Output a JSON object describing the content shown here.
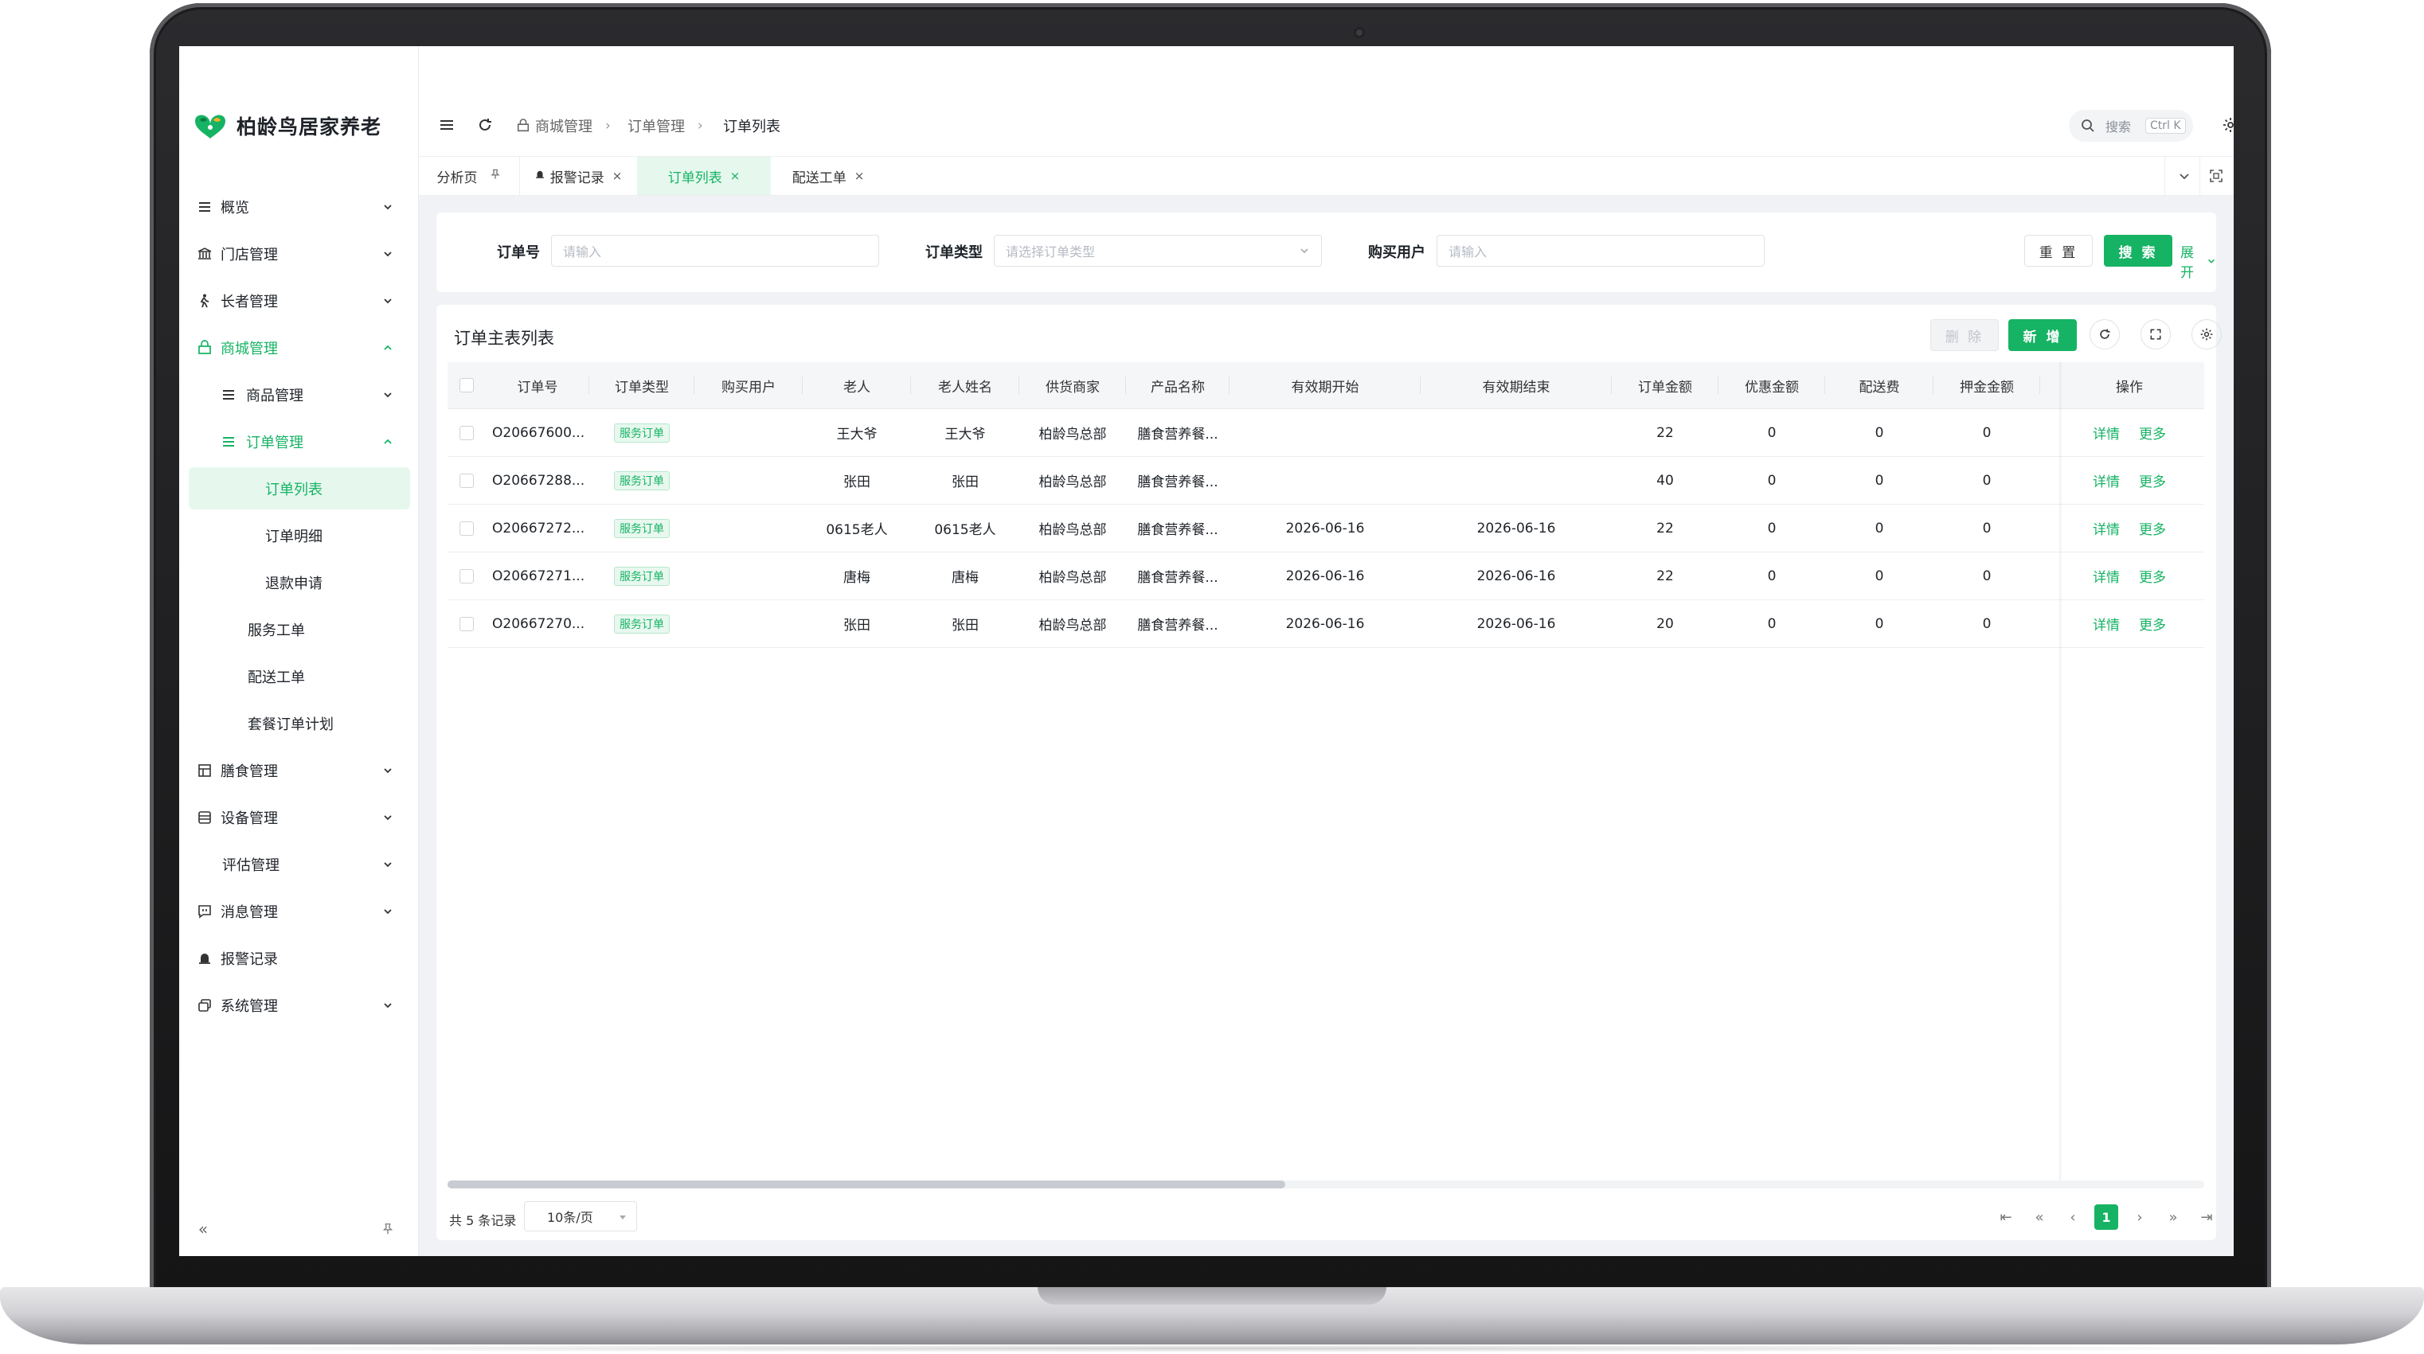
{
  "brand": {
    "name": "柏龄鸟居家养老",
    "accent": "#16b364"
  },
  "sidebar": {
    "items": [
      {
        "label": "概览",
        "icon": "list-icon",
        "chevron": "down"
      },
      {
        "label": "门店管理",
        "icon": "bank-icon",
        "chevron": "down"
      },
      {
        "label": "长者管理",
        "icon": "walking-person-icon",
        "chevron": "down"
      },
      {
        "label": "商城管理",
        "icon": "shop-icon",
        "chevron": "up",
        "expanded": true
      },
      {
        "label": "商品管理",
        "icon": "list-icon",
        "chevron": "down",
        "level": 2
      },
      {
        "label": "订单管理",
        "icon": "list-icon",
        "chevron": "up",
        "level": 2,
        "expanded": true
      },
      {
        "label": "订单列表",
        "level": 3,
        "active": true
      },
      {
        "label": "订单明细",
        "level": 3
      },
      {
        "label": "退款申请",
        "level": 3
      },
      {
        "label": "服务工单",
        "level": 2
      },
      {
        "label": "配送工单",
        "level": 2
      },
      {
        "label": "套餐订单计划",
        "level": 2
      },
      {
        "label": "膳食管理",
        "icon": "grid-icon",
        "chevron": "down"
      },
      {
        "label": "设备管理",
        "icon": "database-icon",
        "chevron": "down"
      },
      {
        "label": "评估管理",
        "chevron": "down"
      },
      {
        "label": "消息管理",
        "icon": "message-icon",
        "chevron": "down"
      },
      {
        "label": "报警记录",
        "icon": "alarm-icon"
      },
      {
        "label": "系统管理",
        "icon": "window-icon",
        "chevron": "down"
      }
    ]
  },
  "header": {
    "breadcrumb": [
      "商城管理",
      "订单管理",
      "订单列表"
    ],
    "search_label": "搜索",
    "search_shortcut": "Ctrl K"
  },
  "tabs": [
    {
      "label": "分析页",
      "pinned": true
    },
    {
      "label": "报警记录",
      "closable": true
    },
    {
      "label": "订单列表",
      "closable": true,
      "active": true
    },
    {
      "label": "配送工单",
      "closable": true
    }
  ],
  "filter": {
    "order_no_label": "订单号",
    "order_no_placeholder": "请输入",
    "order_type_label": "订单类型",
    "order_type_placeholder": "请选择订单类型",
    "buyer_label": "购买用户",
    "buyer_placeholder": "请输入",
    "reset_label": "重 置",
    "search_label": "搜 索",
    "expand_label": "展开"
  },
  "table": {
    "title": "订单主表列表",
    "delete_label": "删 除",
    "add_label": "新 增",
    "columns": [
      "订单号",
      "订单类型",
      "购买用户",
      "老人",
      "老人姓名",
      "供货商家",
      "产品名称",
      "有效期开始",
      "有效期结束",
      "订单金额",
      "优惠金额",
      "配送费",
      "押金金额",
      "操作"
    ],
    "action_detail": "详情",
    "action_more": "更多",
    "rows": [
      {
        "order_no": "O20667600...",
        "type": "服务订单",
        "buyer": "",
        "elder": "王大爷",
        "elder_name": "王大爷",
        "merchant": "柏龄鸟总部",
        "product": "膳食营养餐...",
        "start": "",
        "end": "",
        "amount": "22",
        "discount": "0",
        "delivery": "0",
        "deposit": "0"
      },
      {
        "order_no": "O20667288...",
        "type": "服务订单",
        "buyer": "",
        "elder": "张田",
        "elder_name": "张田",
        "merchant": "柏龄鸟总部",
        "product": "膳食营养餐...",
        "start": "",
        "end": "",
        "amount": "40",
        "discount": "0",
        "delivery": "0",
        "deposit": "0"
      },
      {
        "order_no": "O20667272...",
        "type": "服务订单",
        "buyer": "",
        "elder": "0615老人",
        "elder_name": "0615老人",
        "merchant": "柏龄鸟总部",
        "product": "膳食营养餐...",
        "start": "2026-06-16",
        "end": "2026-06-16",
        "amount": "22",
        "discount": "0",
        "delivery": "0",
        "deposit": "0"
      },
      {
        "order_no": "O20667271...",
        "type": "服务订单",
        "buyer": "",
        "elder": "唐梅",
        "elder_name": "唐梅",
        "merchant": "柏龄鸟总部",
        "product": "膳食营养餐...",
        "start": "2026-06-16",
        "end": "2026-06-16",
        "amount": "22",
        "discount": "0",
        "delivery": "0",
        "deposit": "0"
      },
      {
        "order_no": "O20667270...",
        "type": "服务订单",
        "buyer": "",
        "elder": "张田",
        "elder_name": "张田",
        "merchant": "柏龄鸟总部",
        "product": "膳食营养餐...",
        "start": "2026-06-16",
        "end": "2026-06-16",
        "amount": "20",
        "discount": "0",
        "delivery": "0",
        "deposit": "0"
      }
    ]
  },
  "pager": {
    "total_text": "共 5 条记录",
    "page_size": "10条/页",
    "current_page": "1"
  }
}
